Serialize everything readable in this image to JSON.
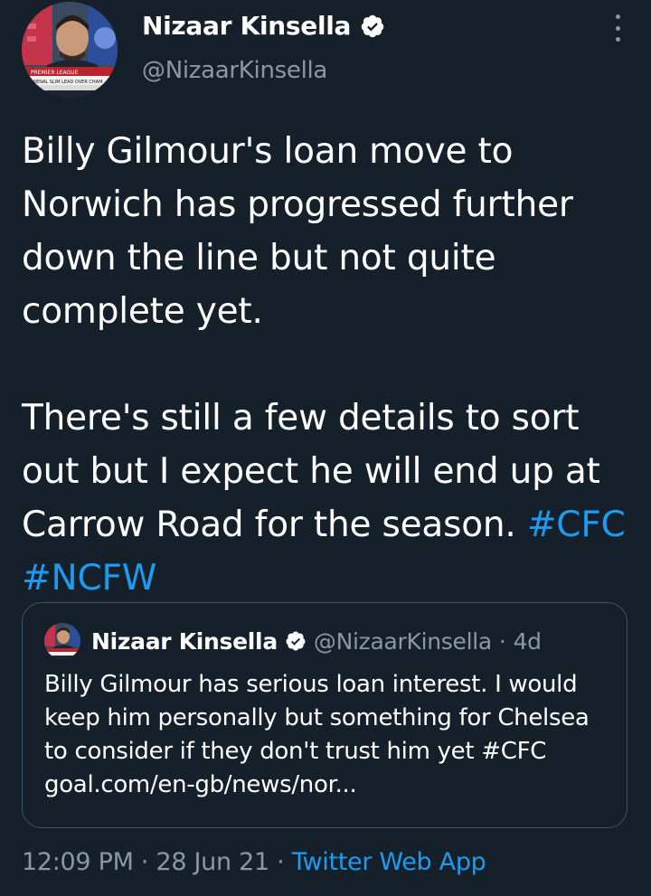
{
  "author": {
    "display_name": "Nizaar Kinsella",
    "handle": "@NizaarKinsella",
    "verified": true,
    "avatar_caption_lines": [
      "PREMIER LEAGUE",
      "ARSENAL SLIM LEAD OVER CHAM"
    ]
  },
  "tweet": {
    "paragraph1": "Billy Gilmour's loan move to Norwich has progressed further down the line but not quite complete yet.",
    "paragraph2_text": "There's still a few details to sort out but I expect he will end up at Carrow Road for the season.",
    "hashtags": [
      "#CFC",
      "#NCFW"
    ]
  },
  "quoted_tweet": {
    "display_name": "Nizaar Kinsella",
    "handle": "@NizaarKinsella",
    "separator": "·",
    "time": "4d",
    "lines": [
      "Billy Gilmour has serious loan interest. I would",
      "keep him personally but something for Chelsea",
      "to consider if they don't trust him yet #CFC",
      "goal.com/en-gb/news/nor..."
    ]
  },
  "meta": {
    "time": "12:09 PM",
    "separator": "·",
    "date": "28 Jun 21",
    "source": "Twitter Web App"
  },
  "colors": {
    "background": "#15202b",
    "accent": "#1d9bf0",
    "secondary_text": "#8b98a5",
    "border": "#3d5466"
  },
  "icons": {
    "verified": "verified-badge-icon",
    "more": "more-vertical-icon"
  }
}
